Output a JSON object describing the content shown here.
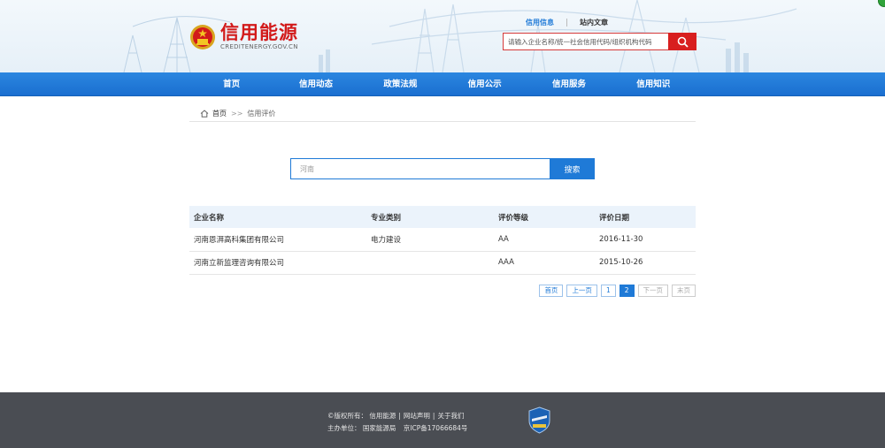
{
  "logo": {
    "name": "信用能源",
    "domain": "CREDITENERGY.GOV.CN"
  },
  "search_tabs": [
    {
      "label": "信用信息",
      "active": true
    },
    {
      "label": "站内文章",
      "active": false
    }
  ],
  "top_search": {
    "placeholder": "请输入企业名称/统一社会信用代码/组织机构代码"
  },
  "nav": [
    "首页",
    "信用动态",
    "政策法规",
    "信用公示",
    "信用服务",
    "信用知识"
  ],
  "breadcrumb": {
    "home": "首页",
    "separator": ">>",
    "current": "信用评价"
  },
  "main_search": {
    "value": "河南",
    "button": "搜索"
  },
  "table": {
    "headers": [
      "企业名称",
      "专业类别",
      "评价等级",
      "评价日期"
    ],
    "rows": [
      [
        "河南恩湃高科集团有限公司",
        "电力建设",
        "AA",
        "2016-11-30"
      ],
      [
        "河南立新监理咨询有限公司",
        "",
        "AAA",
        "2015-10-26"
      ]
    ]
  },
  "pagination": {
    "first": "首页",
    "prev": "上一页",
    "pages": [
      "1",
      "2"
    ],
    "current": "2",
    "next": "下一页",
    "last": "末页"
  },
  "footer": {
    "copyright_label": "©版权所有：",
    "site": "信用能源",
    "link1": "网站声明",
    "link2": "关于我们",
    "host_label": "主办单位：",
    "host": "国家能源局",
    "icp": "京ICP备17066684号"
  },
  "colors": {
    "brand_red": "#d21a1a",
    "primary_blue": "#1f7ad7",
    "footer_bg": "#4a4d53"
  }
}
